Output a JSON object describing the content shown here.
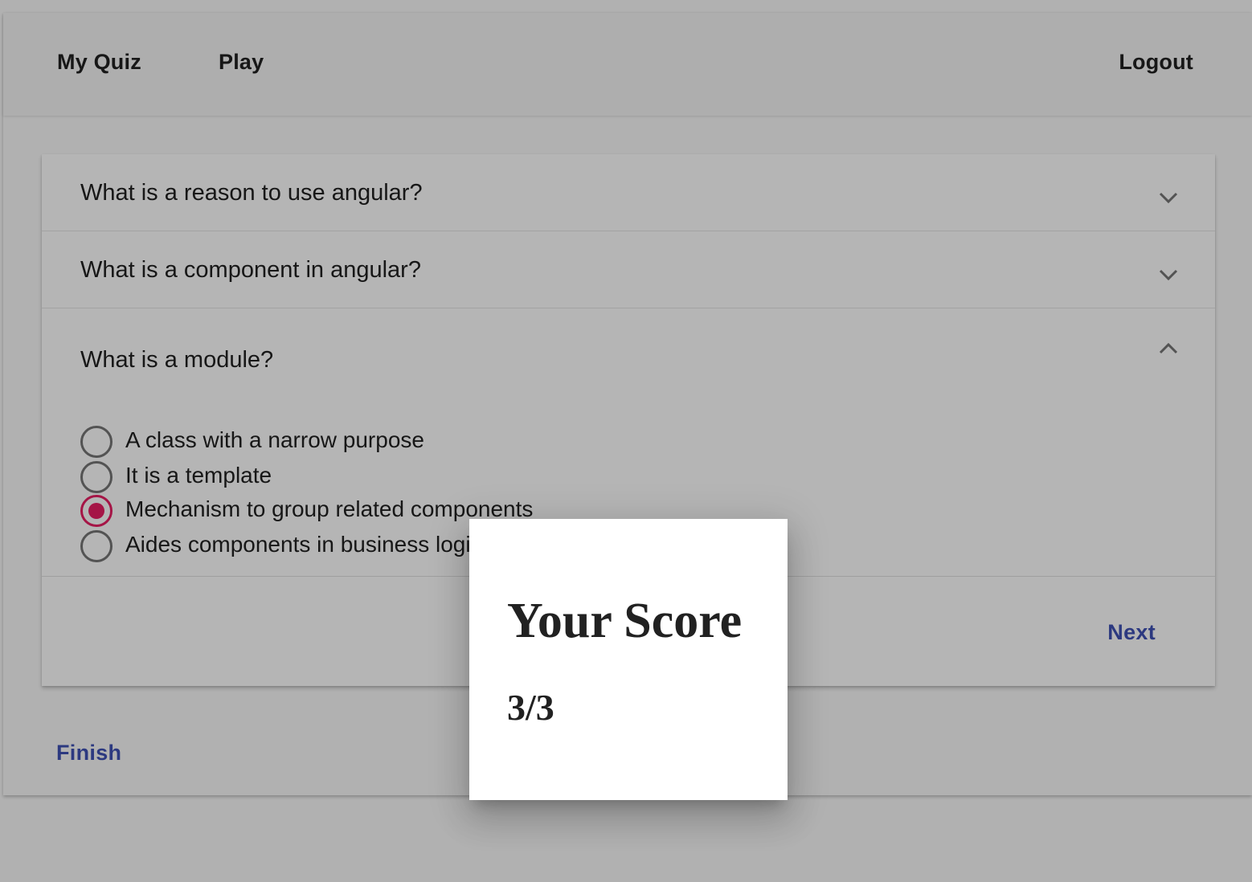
{
  "nav": {
    "brand": "My Quiz",
    "play": "Play",
    "logout": "Logout"
  },
  "questions": [
    {
      "title": "What is a reason to use angular?",
      "expanded": false,
      "icon": "chevron-down-icon"
    },
    {
      "title": "What is a component in angular?",
      "expanded": false,
      "icon": "chevron-down-icon"
    },
    {
      "title": "What is a module?",
      "expanded": true,
      "icon": "chevron-up-icon",
      "options": [
        {
          "label": "A class with a narrow purpose",
          "selected": false
        },
        {
          "label": "It is a template",
          "selected": false
        },
        {
          "label": "Mechanism to group related components",
          "selected": true
        },
        {
          "label": "Aides components in business logic",
          "selected": false
        }
      ]
    }
  ],
  "actions": {
    "next": "Next",
    "finish": "Finish"
  },
  "dialog": {
    "title": "Your Score",
    "score": "3/3"
  },
  "colors": {
    "accent": "#e91e63",
    "primary": "#3f51b5",
    "toolbar": "#f5f5f5"
  }
}
